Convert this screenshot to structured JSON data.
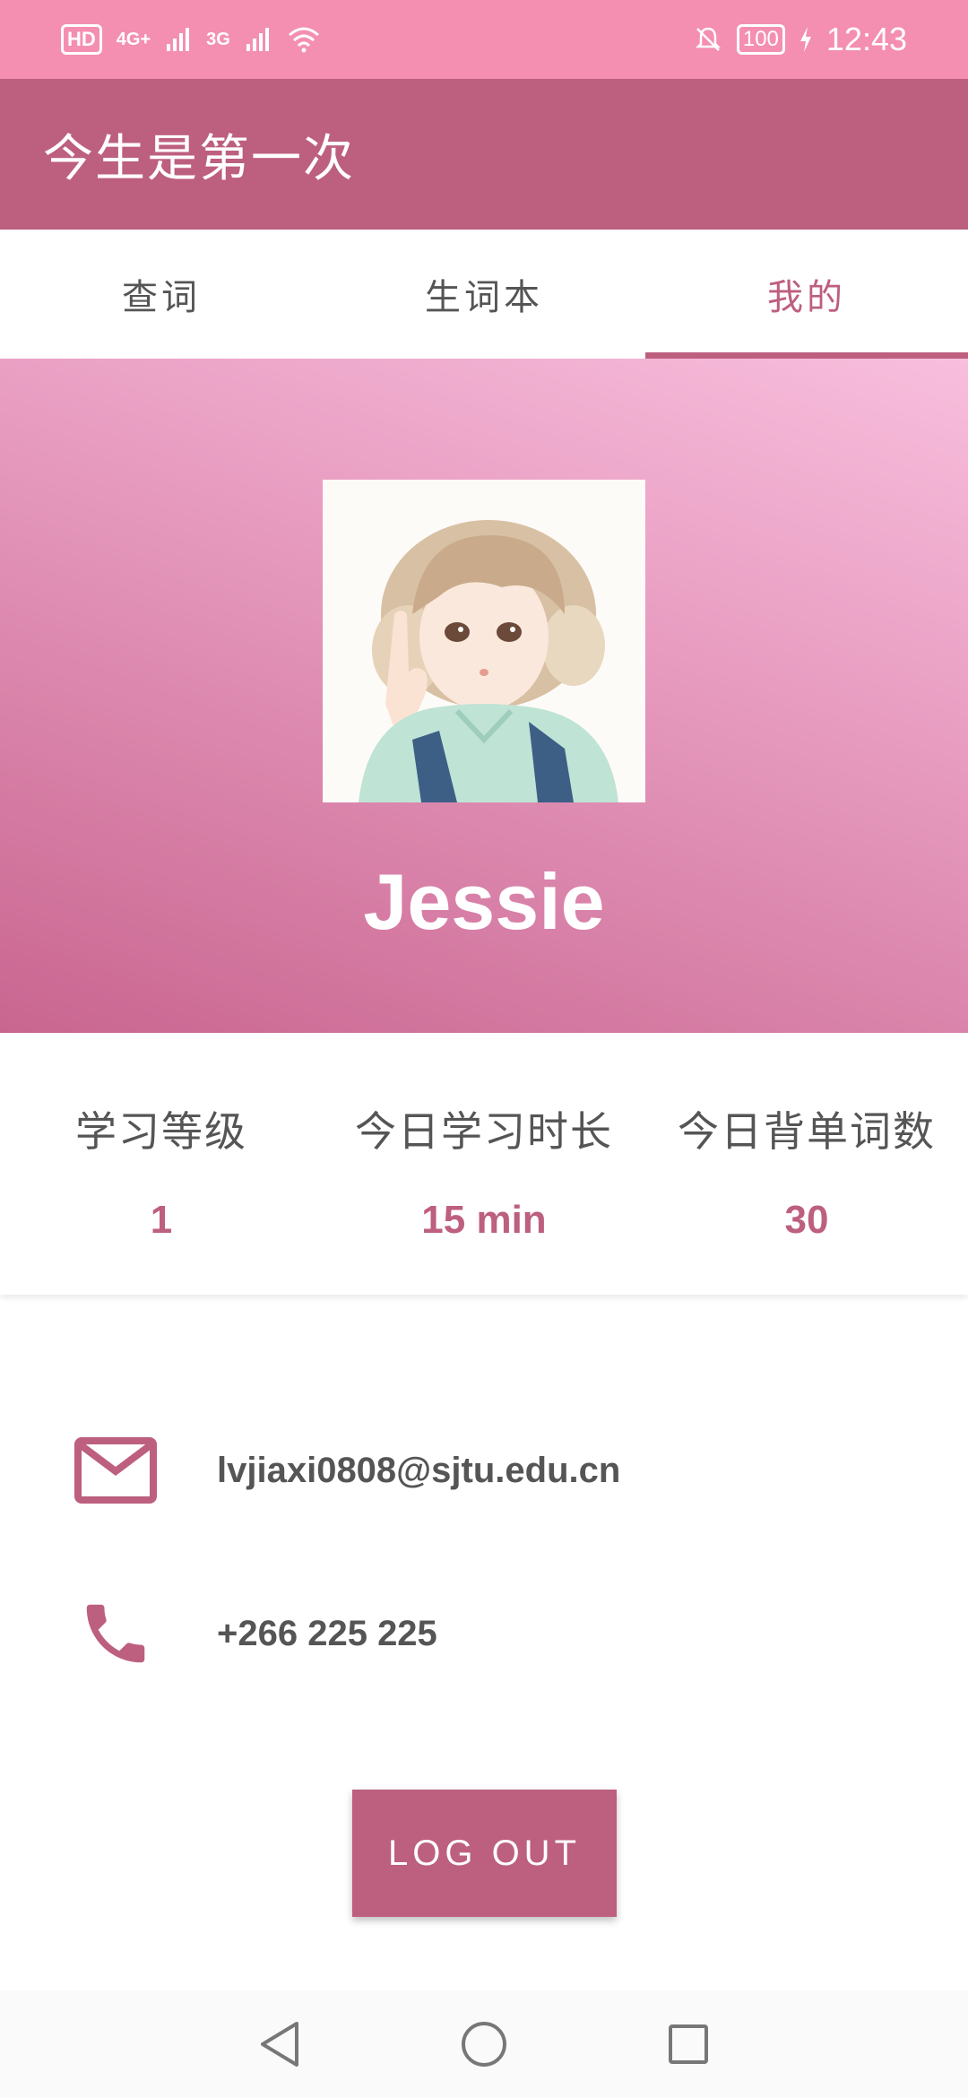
{
  "status_bar": {
    "left_badge": "HD",
    "network_1": "4G+",
    "network_2": "3G",
    "battery": "100",
    "time": "12:43"
  },
  "app_bar": {
    "title": "今生是第一次"
  },
  "tabs": [
    {
      "label": "查词",
      "active": false
    },
    {
      "label": "生词本",
      "active": false
    },
    {
      "label": "我的",
      "active": true
    }
  ],
  "profile": {
    "name": "Jessie"
  },
  "stats": [
    {
      "label": "学习等级",
      "value": "1"
    },
    {
      "label": "今日学习时长",
      "value": "15 min"
    },
    {
      "label": "今日背单词数",
      "value": "30"
    }
  ],
  "contact": {
    "email": "lvjiaxi0808@sjtu.edu.cn",
    "phone": "+266 225 225"
  },
  "logout_label": "LOG OUT",
  "colors": {
    "status_bar": "#f48fb1",
    "primary": "#bd5f7e",
    "text": "#555555"
  },
  "icons": {
    "email": "mail-icon",
    "phone": "phone-icon",
    "nav_back": "back-triangle-icon",
    "nav_home": "home-circle-icon",
    "nav_recent": "recent-square-icon"
  }
}
